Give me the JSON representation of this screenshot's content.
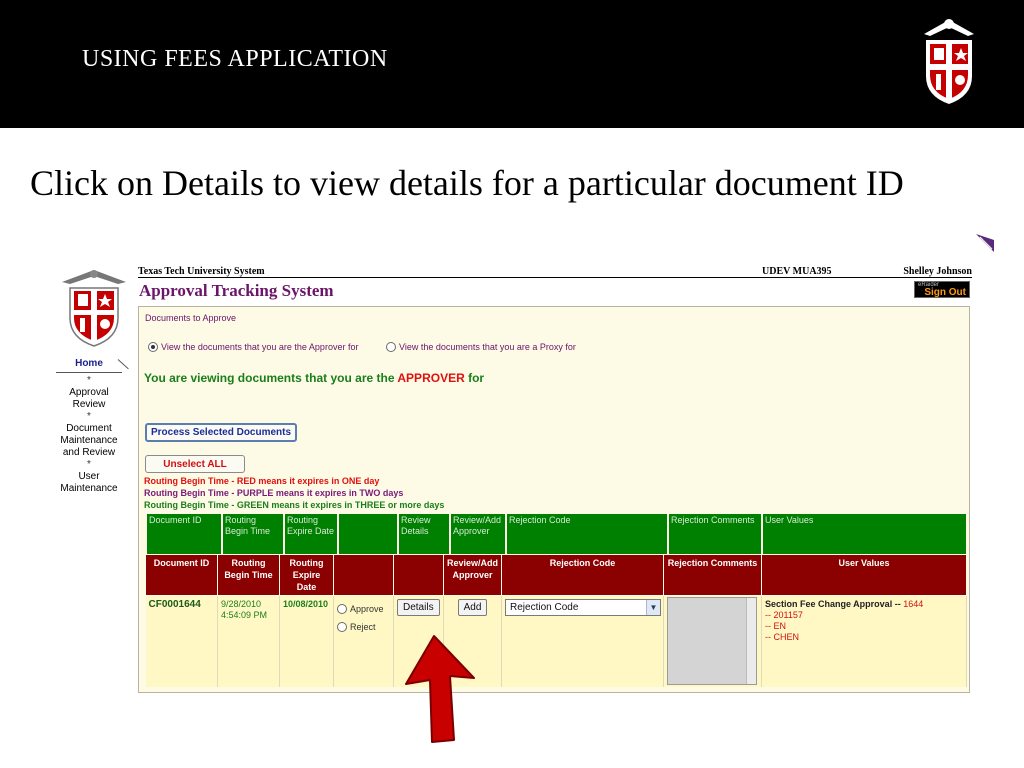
{
  "slide": {
    "title": "USING FEES APPLICATION",
    "subtitle": "Click on Details to view details for a particular document ID",
    "colors": {
      "header_bg": "#000000",
      "arrow": "#c80000"
    }
  },
  "app": {
    "system_name": "Texas Tech University System",
    "env": "UDEV   MUA395",
    "user_name": "Shelley Johnson",
    "title": "Approval Tracking System",
    "signout_small": "eRaider",
    "signout_label": "Sign Out"
  },
  "nav": {
    "home": "Home",
    "separator": "*",
    "items": [
      "Approval Review",
      "Document Maintenance and Review",
      "User Maintenance"
    ]
  },
  "panel": {
    "title": "Documents to Approve",
    "view_options": [
      {
        "label": "View the documents that you are the Approver for",
        "selected": true
      },
      {
        "label": "View the documents that you are a Proxy for",
        "selected": false
      }
    ],
    "viewing_prefix": "You are viewing documents that you are the ",
    "viewing_highlight": "APPROVER",
    "viewing_suffix": " for",
    "process_button": "Process Selected Documents",
    "unselect_button": "Unselect ALL",
    "legend": [
      {
        "text": "Routing Begin Time - RED means it expires in ONE day",
        "color": "#e01010"
      },
      {
        "text": "Routing Begin Time - PURPLE means it expires in TWO days",
        "color": "#7a1a7a"
      },
      {
        "text": "Routing Begin Time - GREEN means it expires in THREE or more days",
        "color": "#1a7f1a"
      }
    ]
  },
  "green_header": [
    "Document ID",
    "Routing Begin Time",
    "Routing Expire Date",
    "",
    "Review Details",
    "Review/Add Approver",
    "Rejection Code",
    "Rejection Comments",
    "User Values"
  ],
  "table": {
    "headers": [
      "Document ID",
      "Routing Begin Time",
      "Routing Expire Date",
      "",
      "",
      "Review/Add Approver",
      "Rejection Code",
      "Rejection Comments",
      "User Values"
    ],
    "row": {
      "doc_id": "CF0001644",
      "begin_date": "9/28/2010",
      "begin_time": "4:54:09 PM",
      "expire": "10/08/2010",
      "approve": "Approve",
      "reject": "Reject",
      "details_button": "Details",
      "add_button": "Add",
      "rejection_code": "Rejection Code",
      "uv_label": "Section Fee Change Approval -- ",
      "uv_id": "1644",
      "uv_lines": [
        "-- 201157",
        "-- EN",
        "-- CHEN"
      ]
    }
  }
}
